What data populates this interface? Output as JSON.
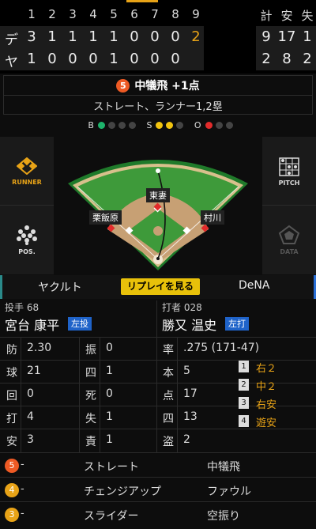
{
  "scoreboard": {
    "innings": [
      "1",
      "2",
      "3",
      "4",
      "5",
      "6",
      "7",
      "8",
      "9"
    ],
    "totals_header": [
      "計",
      "安",
      "失"
    ],
    "rows": [
      {
        "team": "デ",
        "scores": [
          "3",
          "1",
          "1",
          "1",
          "1",
          "0",
          "0",
          "0",
          "2"
        ],
        "totals": [
          "9",
          "17",
          "1"
        ]
      },
      {
        "team": "ヤ",
        "scores": [
          "1",
          "0",
          "0",
          "0",
          "1",
          "0",
          "0",
          "0",
          ""
        ],
        "totals": [
          "2",
          "8",
          "2"
        ]
      }
    ]
  },
  "play": {
    "number": "5",
    "result": "中犠飛 +1点",
    "detail": "ストレート、ランナー1,2塁"
  },
  "count": {
    "b_label": "B",
    "s_label": "S",
    "o_label": "O",
    "balls": 1,
    "strikes": 2,
    "outs": 1,
    "colors": {
      "ball": "#1db36b",
      "strike": "#f2c40f",
      "out": "#e22b2b",
      "off": "#444444"
    }
  },
  "field": {
    "runner_label": "RUNNER",
    "pos_label": "POS.",
    "pitch_label": "PITCH",
    "data_label": "DATA",
    "fielders": [
      "東妻",
      "栗飯原",
      "村川"
    ]
  },
  "teams": {
    "away": "ヤクルト",
    "home": "DeNA",
    "replay_label": "リプレイを見る"
  },
  "pitcher": {
    "role": "投手 68",
    "name": "宮台 康平",
    "hand": "左投",
    "stats": [
      {
        "label": "防",
        "value": "2.30"
      },
      {
        "label": "球",
        "value": "21"
      },
      {
        "label": "回",
        "value": "0"
      },
      {
        "label": "打",
        "value": "4"
      },
      {
        "label": "安",
        "value": "3"
      }
    ],
    "stats2": [
      {
        "label": "振",
        "value": "0"
      },
      {
        "label": "四",
        "value": "1"
      },
      {
        "label": "死",
        "value": "0"
      },
      {
        "label": "失",
        "value": "1"
      },
      {
        "label": "責",
        "value": "1"
      }
    ]
  },
  "batter": {
    "role": "打者 028",
    "name": "勝又 温史",
    "hand": "左打",
    "stats": [
      {
        "label": "率",
        "value": ".275 (171-47)"
      },
      {
        "label": "本",
        "value": "5"
      },
      {
        "label": "点",
        "value": "17"
      },
      {
        "label": "四",
        "value": "13"
      },
      {
        "label": "盗",
        "value": "2"
      }
    ],
    "history": [
      {
        "num": "1",
        "text": "右２"
      },
      {
        "num": "2",
        "text": "中２"
      },
      {
        "num": "3",
        "text": "右安"
      },
      {
        "num": "4",
        "text": "遊安"
      }
    ]
  },
  "pitches": [
    {
      "num": "5",
      "dash": "-",
      "type": "ストレート",
      "result": "中犠飛",
      "color": "#ee5a24"
    },
    {
      "num": "4",
      "dash": "-",
      "type": "チェンジアップ",
      "result": "ファウル",
      "color": "#e8a317"
    },
    {
      "num": "3",
      "dash": "-",
      "type": "スライダー",
      "result": "空振り",
      "color": "#e8a317"
    }
  ]
}
